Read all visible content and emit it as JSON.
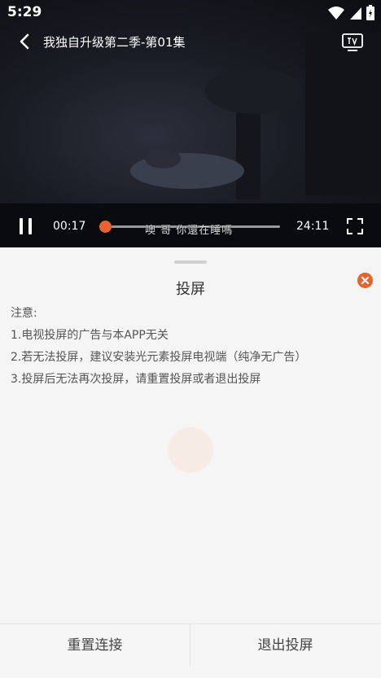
{
  "status_bar": {
    "time": "5:29"
  },
  "player": {
    "title": "我独自升级第二季-第01集",
    "current_time": "00:17",
    "duration": "24:11",
    "subtitle": "噢 哥 你還在睡嗎",
    "progress": 0.012
  },
  "panel": {
    "title": "投屏",
    "notes": [
      "注意:",
      "1.电视投屏的广告与本APP无关",
      "2.若无法投屏，建议安装光元素投屏电视端（纯净无广告）",
      "3.投屏后无法再次投屏，请重置投屏或者退出投屏"
    ],
    "reset_label": "重置连接",
    "exit_label": "退出投屏"
  },
  "colors": {
    "accent": "#e8642c",
    "panel_bg": "#f5f5f5"
  }
}
